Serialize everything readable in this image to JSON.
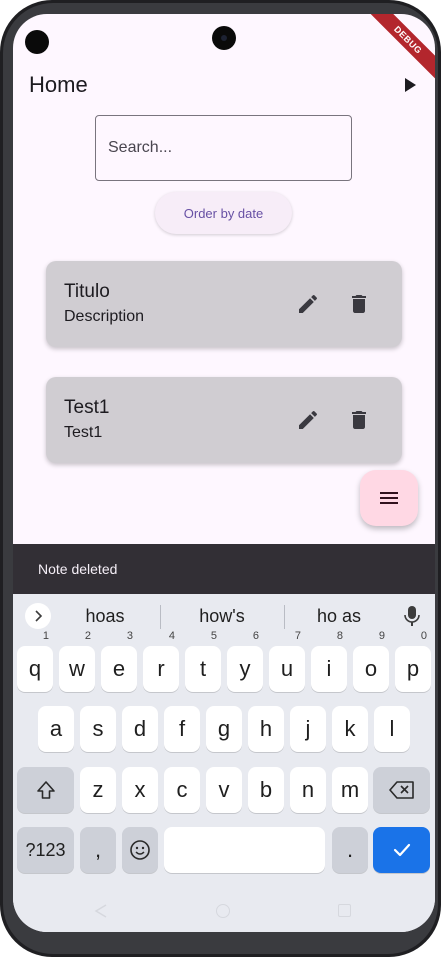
{
  "appbar": {
    "title": "Home"
  },
  "search": {
    "placeholder": "Search..."
  },
  "order_button": {
    "label": "Order by date"
  },
  "notes": [
    {
      "title": "Titulo",
      "description": "Description"
    },
    {
      "title": "Test1",
      "description": "Test1"
    }
  ],
  "snackbar": {
    "message": "Note deleted"
  },
  "debug_banner": "DEBUG",
  "keyboard": {
    "suggestions": [
      "hoas",
      "how's",
      "ho as"
    ],
    "row1": [
      {
        "k": "q",
        "n": "1"
      },
      {
        "k": "w",
        "n": "2"
      },
      {
        "k": "e",
        "n": "3"
      },
      {
        "k": "r",
        "n": "4"
      },
      {
        "k": "t",
        "n": "5"
      },
      {
        "k": "y",
        "n": "6"
      },
      {
        "k": "u",
        "n": "7"
      },
      {
        "k": "i",
        "n": "8"
      },
      {
        "k": "o",
        "n": "9"
      },
      {
        "k": "p",
        "n": "0"
      }
    ],
    "row2": [
      "a",
      "s",
      "d",
      "f",
      "g",
      "h",
      "j",
      "k",
      "l"
    ],
    "row3": [
      "z",
      "x",
      "c",
      "v",
      "b",
      "n",
      "m"
    ],
    "symbols_label": "?123",
    "comma": ",",
    "period": "."
  },
  "colors": {
    "background": "#fef7ff",
    "card": "#d0cdd2",
    "accent": "#6750a4",
    "fab": "#ffd8e4",
    "snackbar": "#322f35",
    "enter_key": "#1a73e8"
  }
}
